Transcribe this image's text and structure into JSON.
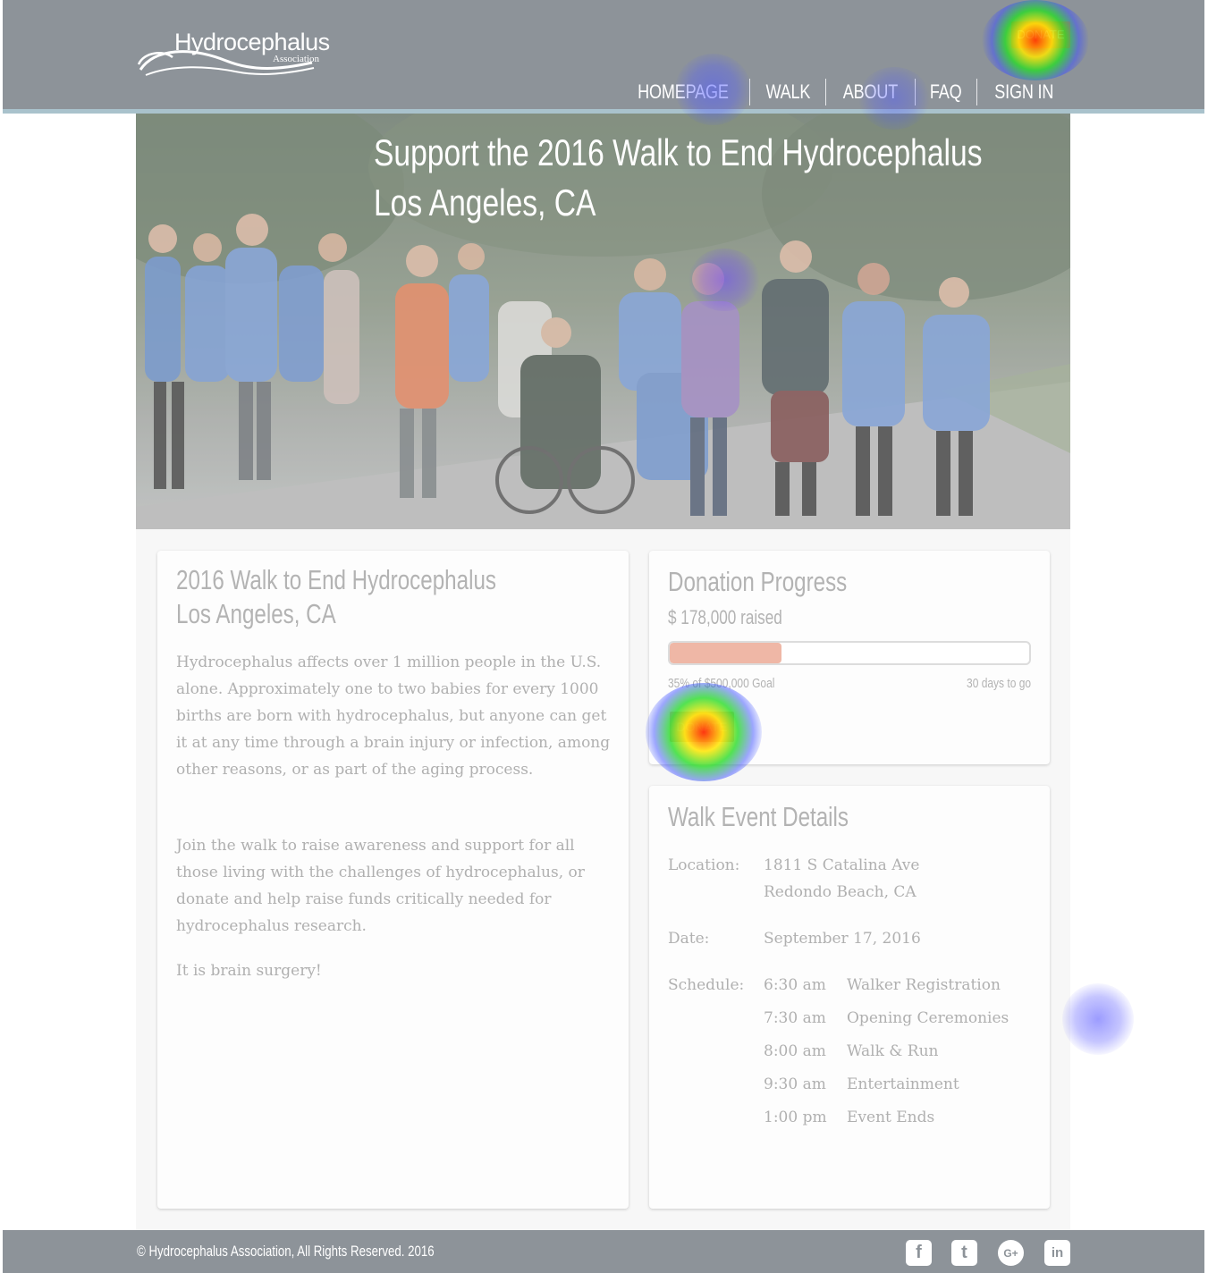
{
  "header": {
    "logo_main": "Hydrocephalus",
    "logo_sub": "Association",
    "donate_label": "DONATE",
    "nav": [
      "HOMEPAGE",
      "WALK",
      "ABOUT",
      "FAQ",
      "SIGN IN"
    ]
  },
  "hero": {
    "title_line1": "Support the 2016 Walk to End Hydrocephalus",
    "title_line2": "Los Angeles, CA"
  },
  "about_card": {
    "title_line1": "2016 Walk to End Hydrocephalus",
    "title_line2": "Los Angeles, CA",
    "paragraph1": "Hydrocephalus affects over 1 million people in the U.S. alone.  Approximately one to two babies for every 1000 births are born with hydrocephalus, but anyone can get it at any time through a brain injury or infection, among other reasons, or as part of the aging process.",
    "paragraph2": "Join the walk to raise awareness and support for all those living with the challenges of hydrocephalus, or donate and help raise funds critically needed for hydrocephalus research.",
    "paragraph3": "It is brain surgery!"
  },
  "progress_card": {
    "title": "Donation Progress",
    "raised": "$ 178,000 raised",
    "progress_fraction": 0.31,
    "goal_text": "35% of $500,000 Goal",
    "days_text": "30 days to go",
    "donate_label": "DONATE"
  },
  "details_card": {
    "title": "Walk Event Details",
    "location_label": "Location:",
    "location_line1": "1811 S Catalina Ave",
    "location_line2": "Redondo Beach, CA",
    "date_label": "Date:",
    "date_value": "September 17, 2016",
    "schedule_label": "Schedule:",
    "schedule": [
      {
        "time": "6:30 am",
        "event": "Walker Registration"
      },
      {
        "time": "7:30 am",
        "event": "Opening Ceremonies"
      },
      {
        "time": "8:00 am",
        "event": "Walk & Run"
      },
      {
        "time": "9:30 am",
        "event": "Entertainment"
      },
      {
        "time": "1:00 pm",
        "event": "Event Ends"
      }
    ]
  },
  "footer": {
    "copyright": "©  Hydrocephalus Association, All Rights Reserved. 2016",
    "social": [
      {
        "icon": "facebook-icon",
        "glyph": "f"
      },
      {
        "icon": "twitter-icon",
        "glyph": "t"
      },
      {
        "icon": "google-plus-icon",
        "glyph": "G+"
      },
      {
        "icon": "linkedin-icon",
        "glyph": "in"
      }
    ]
  },
  "colors": {
    "header_bg": "#8d9399",
    "donate_bg": "#e56a50",
    "progress_fill": "#efb7a6",
    "card_text": "#b0b0b0"
  }
}
